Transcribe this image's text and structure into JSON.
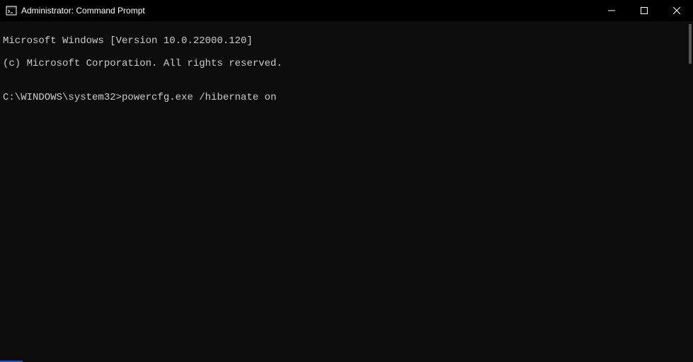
{
  "titlebar": {
    "title": "Administrator: Command Prompt"
  },
  "terminal": {
    "line1": "Microsoft Windows [Version 10.0.22000.120]",
    "line2": "(c) Microsoft Corporation. All rights reserved.",
    "blank": "",
    "prompt": "C:\\WINDOWS\\system32>",
    "command": "powercfg.exe /hibernate on"
  }
}
